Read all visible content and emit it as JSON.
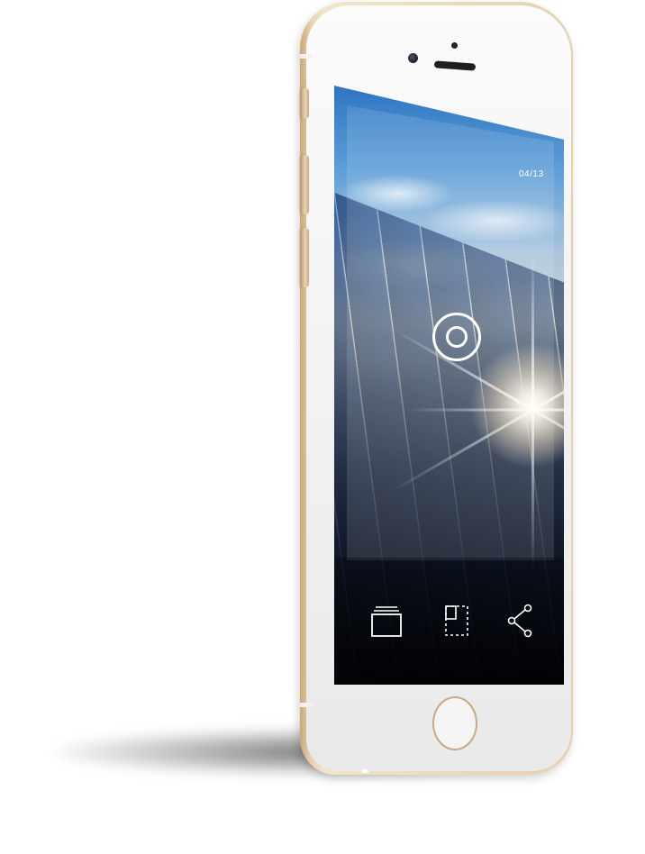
{
  "screen": {
    "photo_counter": "04/13"
  },
  "toolbar": {
    "items": [
      {
        "name": "gallery-icon"
      },
      {
        "name": "crop-icon"
      },
      {
        "name": "share-icon"
      }
    ]
  },
  "colors": {
    "phone_frame": "#e6cfae",
    "phone_face": "#f4f4f4",
    "icon_color": "#ffffff"
  }
}
